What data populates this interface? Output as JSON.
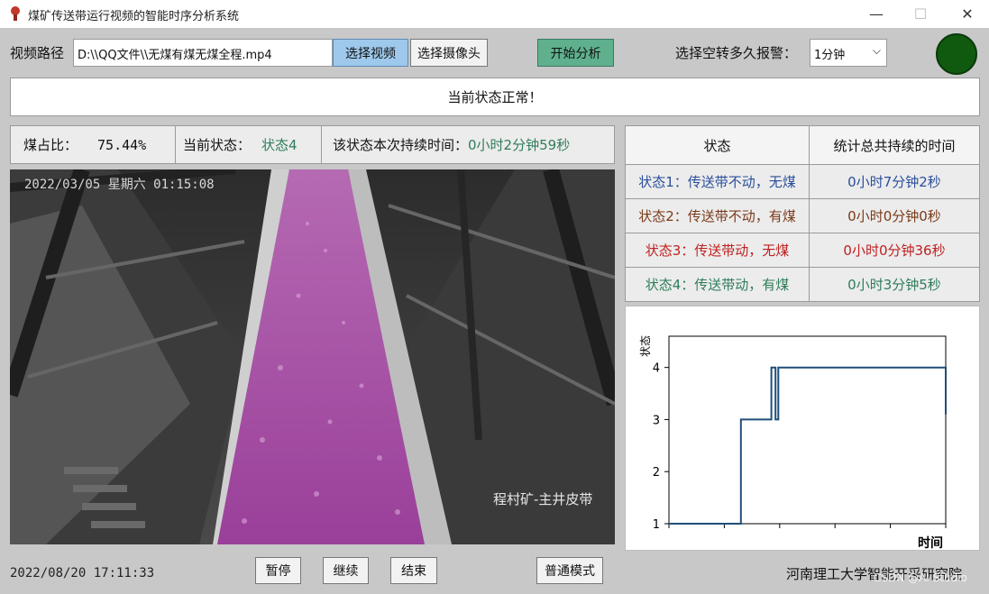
{
  "window": {
    "title": "煤矿传送带运行视频的智能时序分析系统",
    "minimize": "—",
    "maximize": "☐",
    "close": "✕"
  },
  "toolbar": {
    "path_label": "视频路径",
    "path_value": "D:\\\\QQ文件\\\\无煤有煤无煤全程.mp4",
    "select_video": "选择视频",
    "select_camera": "选择摄像头",
    "start_analysis": "开始分析",
    "alarm_label": "选择空转多久报警：",
    "alarm_value": "1分钟",
    "alarm_light_color": "#0f5a0f"
  },
  "banner": {
    "text": "当前状态正常！"
  },
  "info": {
    "coal_ratio_label": "煤占比：",
    "coal_ratio_value": "75.44%",
    "state_label": "当前状态：",
    "state_value": "状态4",
    "duration_label": "该状态本次持续时间：",
    "duration_value": "0小时2分钟59秒"
  },
  "video": {
    "timestamp": "2022/03/05 星期六 01:15:08",
    "caption": "程村矿-主井皮带"
  },
  "state_table": {
    "headers": [
      "状态",
      "统计总共持续的时间"
    ],
    "rows": [
      {
        "state": "状态1：传送带不动，无煤",
        "time": "0小时7分钟2秒",
        "color": "#2a4f9a"
      },
      {
        "state": "状态2：传送带不动，有煤",
        "time": "0小时0分钟0秒",
        "color": "#7a3a1a"
      },
      {
        "state": "状态3：传送带动，无煤",
        "time": "0小时0分钟36秒",
        "color": "#c02020"
      },
      {
        "state": "状态4：传送带动，有煤",
        "time": "0小时3分钟5秒",
        "color": "#2f7d5a"
      }
    ]
  },
  "chart_data": {
    "type": "line",
    "ylabel": "状态",
    "xlabel": "时间",
    "ylim": [
      1,
      4.6
    ],
    "yticks": [
      "1",
      "2",
      "3",
      "4"
    ],
    "series": [
      {
        "x": [
          0,
          0.26,
          0.26,
          0.37,
          0.37,
          0.385,
          0.385,
          0.395,
          0.395,
          0.405,
          0.405,
          1.0,
          1.0
        ],
        "y": [
          1,
          1,
          3,
          3,
          4,
          4,
          3,
          3,
          4,
          4,
          4,
          4,
          3.1
        ]
      }
    ]
  },
  "footer": {
    "datetime": "2022/08/20 17:11:33",
    "pause": "暂停",
    "resume": "继续",
    "end": "结束",
    "mode": "普通模式",
    "institute": "河南理工大学智能开采研究院",
    "watermark": "CSDN @AI Studio"
  }
}
